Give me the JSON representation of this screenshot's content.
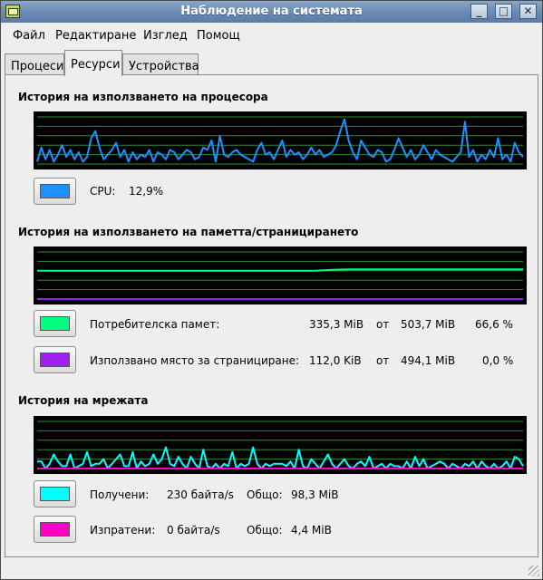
{
  "window": {
    "title": "Наблюдение на системата",
    "buttons": {
      "minimize": "_",
      "maximize": "□",
      "close": "✕"
    }
  },
  "menubar": {
    "items": [
      {
        "label": "Файл"
      },
      {
        "label": "Редактиране"
      },
      {
        "label": "Изглед"
      },
      {
        "label": "Помощ"
      }
    ]
  },
  "tabs": [
    {
      "label": "Процеси",
      "active": false
    },
    {
      "label": "Ресурси",
      "active": true
    },
    {
      "label": "Устройства",
      "active": false
    }
  ],
  "cpu": {
    "title": "История на използването на процесора",
    "label": "CPU:",
    "value": "12,9%",
    "color": "#1e90ff"
  },
  "memory": {
    "title": "История на използването на паметта/страницирането",
    "user": {
      "label": "Потребителска памет:",
      "used": "335,3 MiB",
      "of": "от",
      "total": "503,7 MiB",
      "percent": "66,6 %",
      "color": "#00ff7f"
    },
    "swap": {
      "label": "Използвано място за странициране:",
      "used": "112,0 KiB",
      "of": "от",
      "total": "494,1 MiB",
      "percent": "0,0 %",
      "color": "#a020f0"
    }
  },
  "network": {
    "title": "История на мрежата",
    "received": {
      "label": "Получени:",
      "rate": "230 байта/s",
      "total_label": "Общо:",
      "total": "98,3 MiB",
      "color": "#00ffff"
    },
    "sent": {
      "label": "Изпратени:",
      "rate": "0 байта/s",
      "total_label": "Общо:",
      "total": "4,4 MiB",
      "color": "#ff00c8"
    }
  },
  "chart_data": [
    {
      "type": "line",
      "series": [
        {
          "name": "CPU",
          "color": "#1e90ff",
          "values": [
            0.05,
            0.35,
            0.1,
            0.3,
            0.05,
            0.2,
            0.4,
            0.15,
            0.3,
            0.1,
            0.25,
            0.05,
            0.15,
            0.55,
            0.7,
            0.35,
            0.1,
            0.2,
            0.3,
            0.45,
            0.15,
            0.3,
            0.05,
            0.25,
            0.1,
            0.2,
            0.15,
            0.3,
            0.05,
            0.25,
            0.2,
            0.1,
            0.3,
            0.25,
            0.1,
            0.2,
            0.3,
            0.25,
            0.1,
            0.15,
            0.35,
            0.3,
            0.5,
            0.05,
            0.6,
            0.2,
            0.15,
            0.25,
            0.3,
            0.2,
            0.15,
            0.1,
            0.05,
            0.3,
            0.45,
            0.2,
            0.25,
            0.1,
            0.3,
            0.5,
            0.15,
            0.3,
            0.2,
            0.25,
            0.1,
            0.2,
            0.35,
            0.2,
            0.3,
            0.15,
            0.2,
            0.25,
            0.4,
            0.7,
            0.95,
            0.5,
            0.25,
            0.1,
            0.5,
            0.35,
            0.2,
            0.15,
            0.3,
            0.25,
            0.05,
            0.1,
            0.3,
            0.55,
            0.35,
            0.15,
            0.3,
            0.1,
            0.2,
            0.4,
            0.25,
            0.1,
            0.3,
            0.2,
            0.15,
            0.1,
            0.05,
            0.15,
            0.25,
            0.9,
            0.15,
            0.3,
            0.05,
            0.2,
            0.1,
            0.3,
            0.15,
            0.55,
            0.1,
            0.2,
            0.05,
            0.45,
            0.25,
            0.15
          ]
        }
      ]
    },
    {
      "type": "line",
      "series": [
        {
          "name": "Потребителска памет",
          "color": "#00ff7f",
          "values": [
            0.6,
            0.6,
            0.6,
            0.6,
            0.6,
            0.6,
            0.6,
            0.6,
            0.6,
            0.6,
            0.6,
            0.6,
            0.6,
            0.6,
            0.6,
            0.6,
            0.6,
            0.62,
            0.63,
            0.63,
            0.63,
            0.63,
            0.63,
            0.63,
            0.63,
            0.63,
            0.63,
            0.63,
            0.63
          ]
        },
        {
          "name": "Използвано място за странициране",
          "color": "#a020f0",
          "values": [
            0,
            0,
            0,
            0,
            0,
            0,
            0,
            0,
            0,
            0,
            0,
            0,
            0,
            0,
            0,
            0,
            0,
            0,
            0,
            0,
            0,
            0,
            0,
            0,
            0,
            0,
            0,
            0,
            0
          ]
        }
      ]
    },
    {
      "type": "line",
      "series": [
        {
          "name": "Получени",
          "color": "#00ffff",
          "values": [
            0.15,
            0.15,
            0.0,
            0.1,
            0.3,
            0.15,
            0.05,
            0.05,
            0.3,
            0.0,
            0.05,
            0.1,
            0.35,
            0.05,
            0.1,
            0.1,
            0.2,
            0.0,
            0.1,
            0.2,
            0.3,
            0.05,
            0.05,
            0.35,
            0.0,
            0.15,
            0.05,
            0.1,
            0.3,
            0.1,
            0.2,
            0.45,
            0.1,
            0.05,
            0.25,
            0.1,
            0.0,
            0.25,
            0.1,
            0.0,
            0.4,
            0.05,
            0.0,
            0.1,
            0.0,
            0.1,
            0.05,
            0.35,
            0.0,
            0.1,
            0.05,
            0.1,
            0.45,
            0.1,
            0.0,
            0.1,
            0.05,
            0.1,
            0.1,
            0.1,
            0.05,
            0.15,
            0.0,
            0.4,
            0.05,
            0.0,
            0.2,
            0.1,
            0.0,
            0.15,
            0.3,
            0.1,
            0.0,
            0.1,
            0.2,
            0.05,
            0.0,
            0.1,
            0.15,
            0.05,
            0.25,
            0.0,
            0.05,
            0.1,
            0.0,
            0.1,
            0.05,
            0.05,
            0.0,
            0.15,
            0.0,
            0.25,
            0.05,
            0.2,
            0.0,
            0.05,
            0.1,
            0.15,
            0.1,
            0.0,
            0.1,
            0.05,
            0.0,
            0.1,
            0.05,
            0.15,
            0.0,
            0.15,
            0.05,
            0.0,
            0.1,
            0.0,
            0.05,
            0.15,
            0.0,
            0.25,
            0.2,
            0.05
          ]
        },
        {
          "name": "Изпратени",
          "color": "#ff00c8",
          "values": [
            0,
            0,
            0,
            0,
            0,
            0,
            0,
            0,
            0,
            0,
            0,
            0,
            0,
            0,
            0,
            0,
            0,
            0,
            0,
            0
          ]
        }
      ]
    }
  ]
}
